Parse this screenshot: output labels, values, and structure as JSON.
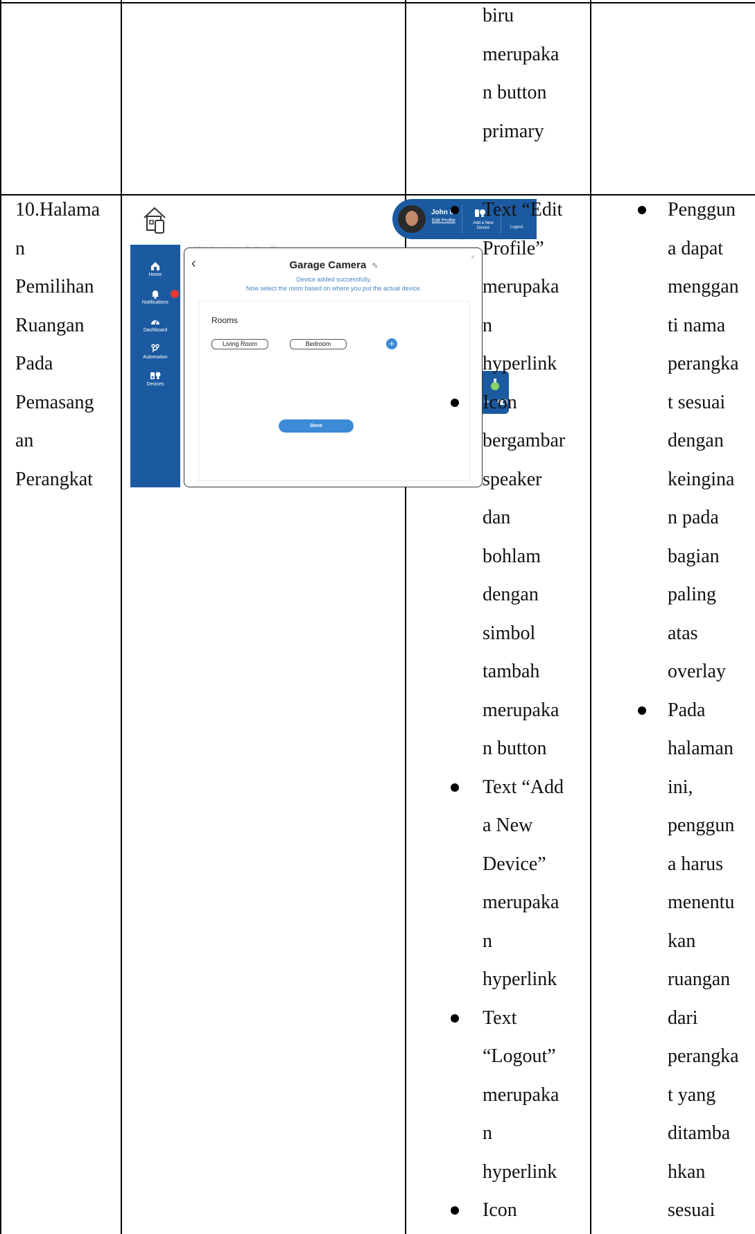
{
  "row_top": {
    "col3_lines": [
      "biru",
      "merupaka",
      "n button",
      "primary"
    ]
  },
  "row10": {
    "col1_lines": [
      "10.Halama",
      "n",
      "Pemilihan",
      "Ruangan",
      "Pada",
      "Pemasang",
      "an",
      "Perangkat"
    ],
    "col3_bullets": [
      [
        "Text “Edit",
        "Profile”",
        "merupaka",
        "n",
        "hyperlink"
      ],
      [
        "Icon",
        "bergambar",
        "speaker",
        "dan",
        "bohlam",
        "dengan",
        "simbol",
        "tambah",
        "merupaka",
        "n button"
      ],
      [
        "Text “Add",
        "a New",
        "Device”",
        "merupaka",
        "n",
        "hyperlink"
      ],
      [
        "Text",
        "“Logout”",
        "merupaka",
        "n",
        "hyperlink"
      ],
      [
        "Icon"
      ]
    ],
    "col4_bullets": [
      [
        "Penggun",
        "a dapat",
        "menggan",
        "ti nama",
        "perangka",
        "t sesuai",
        "dengan",
        "keingina",
        "n pada",
        "bagian",
        "paling",
        "atas",
        "overlay"
      ],
      [
        "Pada",
        "halaman",
        "ini,",
        "penggun",
        "a harus",
        "menentu",
        "kan",
        "ruangan",
        "dari",
        "perangka",
        "t yang",
        "ditamba",
        "hkan",
        "sesuai"
      ]
    ]
  },
  "screenshot": {
    "sidebar": [
      "Home",
      "Notifications",
      "Dashboard",
      "Automation",
      "Devices"
    ],
    "user_name": "John D",
    "edit_profile": "Edit Profile",
    "add_device": "Add a New Device",
    "logout": "Logout",
    "modal": {
      "title": "Garage Camera",
      "subtitle1": "Device added successfully,",
      "subtitle2": "Now select the room based on where you put the actual device.",
      "rooms_label": "Rooms",
      "room_options": [
        "Living Room",
        "Bedroom"
      ],
      "done_label": "Done"
    },
    "bulb_card_text": "ive",
    "colors": {
      "sidebar": "#1b5aa0",
      "accent": "#3d8ad6",
      "notification": "#e53935"
    }
  }
}
